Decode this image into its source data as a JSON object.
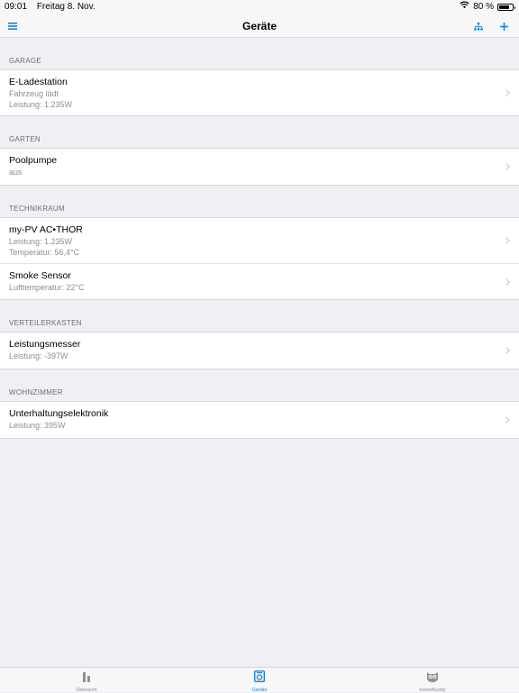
{
  "status_bar": {
    "time": "09:01",
    "date": "Freitag 8. Nov.",
    "battery": "80 %",
    "battery_level": 0.8
  },
  "nav": {
    "title": "Geräte",
    "accent_color": "#1a82d8"
  },
  "sections": [
    {
      "header": "GARAGE",
      "rows": [
        {
          "title": "E-Ladestation",
          "lines": [
            "Fahrzeug lädt",
            "Leistung: 1.235W"
          ]
        }
      ]
    },
    {
      "header": "GARTEN",
      "rows": [
        {
          "title": "Poolpumpe",
          "lines": [
            "aus"
          ]
        }
      ]
    },
    {
      "header": "TECHNIKRAUM",
      "rows": [
        {
          "title": "my-PV AC•THOR",
          "lines": [
            "Leistung: 1.235W",
            "Temperatur: 56,4°C"
          ]
        },
        {
          "title": "Smoke Sensor",
          "lines": [
            "Lufttemperatur: 22°C"
          ]
        }
      ]
    },
    {
      "header": "VERTEILERKASTEN",
      "rows": [
        {
          "title": "Leistungsmesser",
          "lines": [
            "Leistung: -397W"
          ]
        }
      ]
    },
    {
      "header": "WOHNZIMMER",
      "rows": [
        {
          "title": "Unterhaltungselektronik",
          "lines": [
            "Leistung: 395W"
          ]
        }
      ]
    }
  ],
  "tabs": [
    {
      "label": "Übersicht",
      "icon": "bar-chart-icon",
      "active": false
    },
    {
      "label": "Geräte",
      "icon": "device-icon",
      "active": true
    },
    {
      "label": "homeBuddy",
      "icon": "owl-icon",
      "active": false
    }
  ]
}
